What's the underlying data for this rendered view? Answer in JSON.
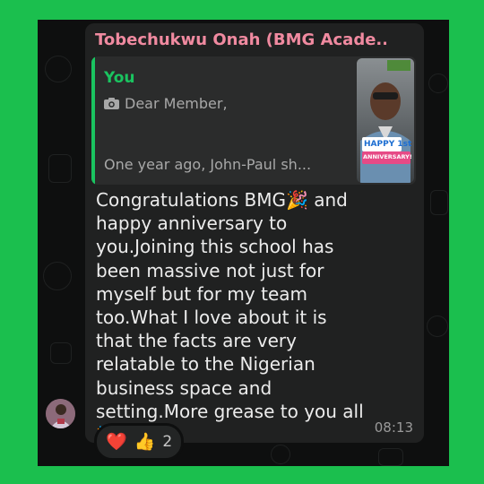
{
  "message": {
    "sender": "Tobechukwu Onah (BMG Acade...",
    "quote": {
      "author": "You",
      "camera_icon": "camera-icon",
      "line1": "Dear Member,",
      "line2": "One year ago, John-Paul sh...",
      "thumbnail_caption_top": "HAPPY 1st",
      "thumbnail_caption_bottom": "ANNIVERSARY!"
    },
    "body": "Congratulations BMG🎉 and happy anniversary to you.Joining this school has been massive not just for myself but for my team too.What I love about it is that the facts are very relatable to the Nigerian business space and setting.More grease to you all🎉🎉",
    "time": "08:13"
  },
  "reactions": {
    "emojis": [
      "❤️",
      "👍"
    ],
    "count": "2"
  },
  "colors": {
    "background_green": "#1bbf4e",
    "chat_bg": "#0e0f0f",
    "sender_name": "#f08aa0",
    "quote_accent": "#1ac460"
  }
}
